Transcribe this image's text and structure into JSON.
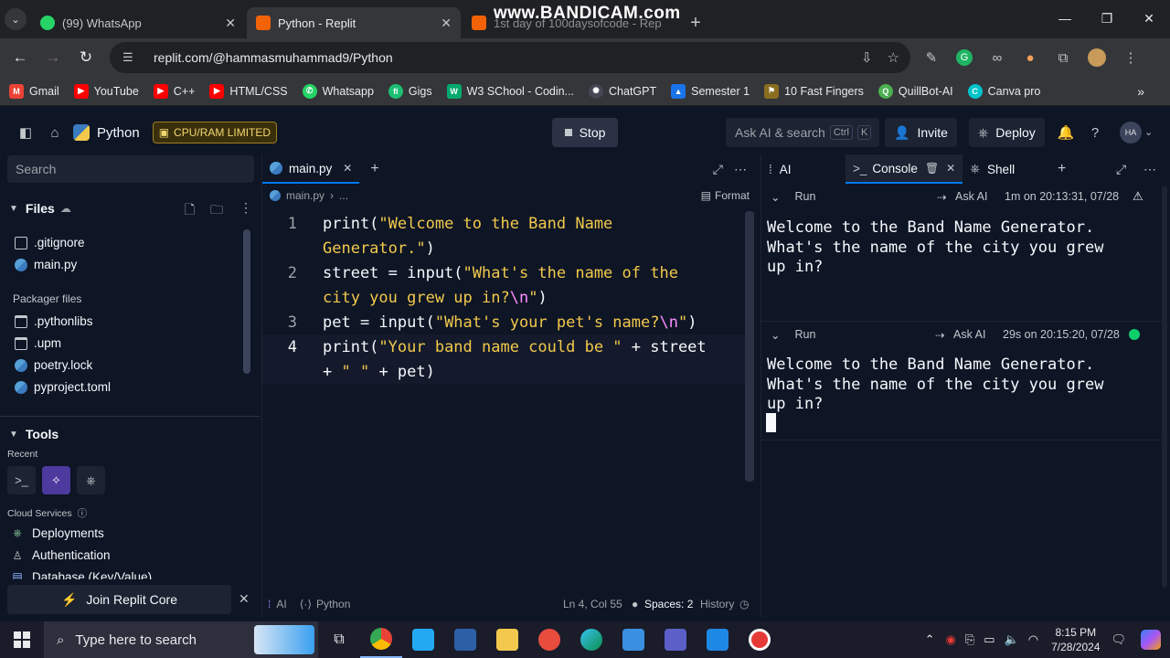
{
  "browser": {
    "tabs": [
      {
        "title": "(99) WhatsApp",
        "favicon_color": "#25d366",
        "active": false
      },
      {
        "title": "Python - Replit",
        "favicon_color": "#f26207",
        "active": true
      },
      {
        "title": "1st day of 100daysofcode - Rep",
        "favicon_color": "#f26207",
        "active": false
      }
    ],
    "watermark": "www.BANDICAM.com",
    "url": "replit.com/@hammasmuhammad9/Python",
    "bookmarks": [
      {
        "label": "Gmail",
        "color": "#ea4335",
        "glyph": "M"
      },
      {
        "label": "YouTube",
        "color": "#ff0000",
        "glyph": "▶"
      },
      {
        "label": "C++",
        "color": "#ff0000",
        "glyph": "▶"
      },
      {
        "label": "HTML/CSS",
        "color": "#ff0000",
        "glyph": "▶"
      },
      {
        "label": "Whatsapp",
        "color": "#25d366",
        "glyph": "✆"
      },
      {
        "label": "Gigs",
        "color": "#1dbf73",
        "glyph": "fi"
      },
      {
        "label": "W3 SChool - Codin...",
        "color": "#04aa6d",
        "glyph": "W"
      },
      {
        "label": "ChatGPT",
        "color": "#444654",
        "glyph": "✺"
      },
      {
        "label": "Semester 1",
        "color": "#1a73e8",
        "glyph": "▲"
      },
      {
        "label": "10 Fast Fingers",
        "color": "#8a6d1f",
        "glyph": "⚑"
      },
      {
        "label": "QuillBot-AI",
        "color": "#4caf50",
        "glyph": "Q"
      },
      {
        "label": "Canva pro",
        "color": "#00c4cc",
        "glyph": "C"
      }
    ]
  },
  "replit": {
    "repl_name": "Python",
    "cpu_badge": "CPU/RAM LIMITED",
    "stop_label": "Stop",
    "ask_ai_placeholder": "Ask AI & search",
    "kbd_ctrl": "Ctrl",
    "kbd_k": "K",
    "invite_label": "Invite",
    "deploy_label": "Deploy",
    "avatar_initials": "HA",
    "sidebar": {
      "search_placeholder": "Search",
      "files_title": "Files",
      "files": [
        ".gitignore",
        "main.py"
      ],
      "packager_title": "Packager files",
      "packager_files": [
        ".pythonlibs",
        ".upm",
        "poetry.lock",
        "pyproject.toml"
      ],
      "tools_title": "Tools",
      "recent_label": "Recent",
      "cloud_label": "Cloud Services",
      "cloud_items": [
        "Deployments",
        "Authentication",
        "Database (Key/Value)"
      ],
      "join_core": "Join Replit Core"
    },
    "editor": {
      "tab_name": "main.py",
      "breadcrumb_file": "main.py",
      "breadcrumb_more": "...",
      "format_label": "Format",
      "status": {
        "ai": "AI",
        "lang": "Python",
        "position": "Ln 4, Col 55",
        "spaces": "Spaces: 2",
        "history": "History"
      }
    },
    "console": {
      "tabs": [
        "AI",
        "Console",
        "Shell"
      ],
      "runs": [
        {
          "label": "Run",
          "ask_ai": "Ask AI",
          "time": "1m on 20:13:31, 07/28",
          "output": "Welcome to the Band Name Generator.\nWhat's the name of the city you grew\nup in?"
        },
        {
          "label": "Run",
          "ask_ai": "Ask AI",
          "time": "29s on 20:15:20, 07/28",
          "output": "Welcome to the Band Name Generator.\nWhat's the name of the city you grew\nup in?"
        }
      ]
    }
  },
  "taskbar": {
    "search_placeholder": "Type here to search",
    "time": "8:15 PM",
    "date": "7/28/2024"
  }
}
